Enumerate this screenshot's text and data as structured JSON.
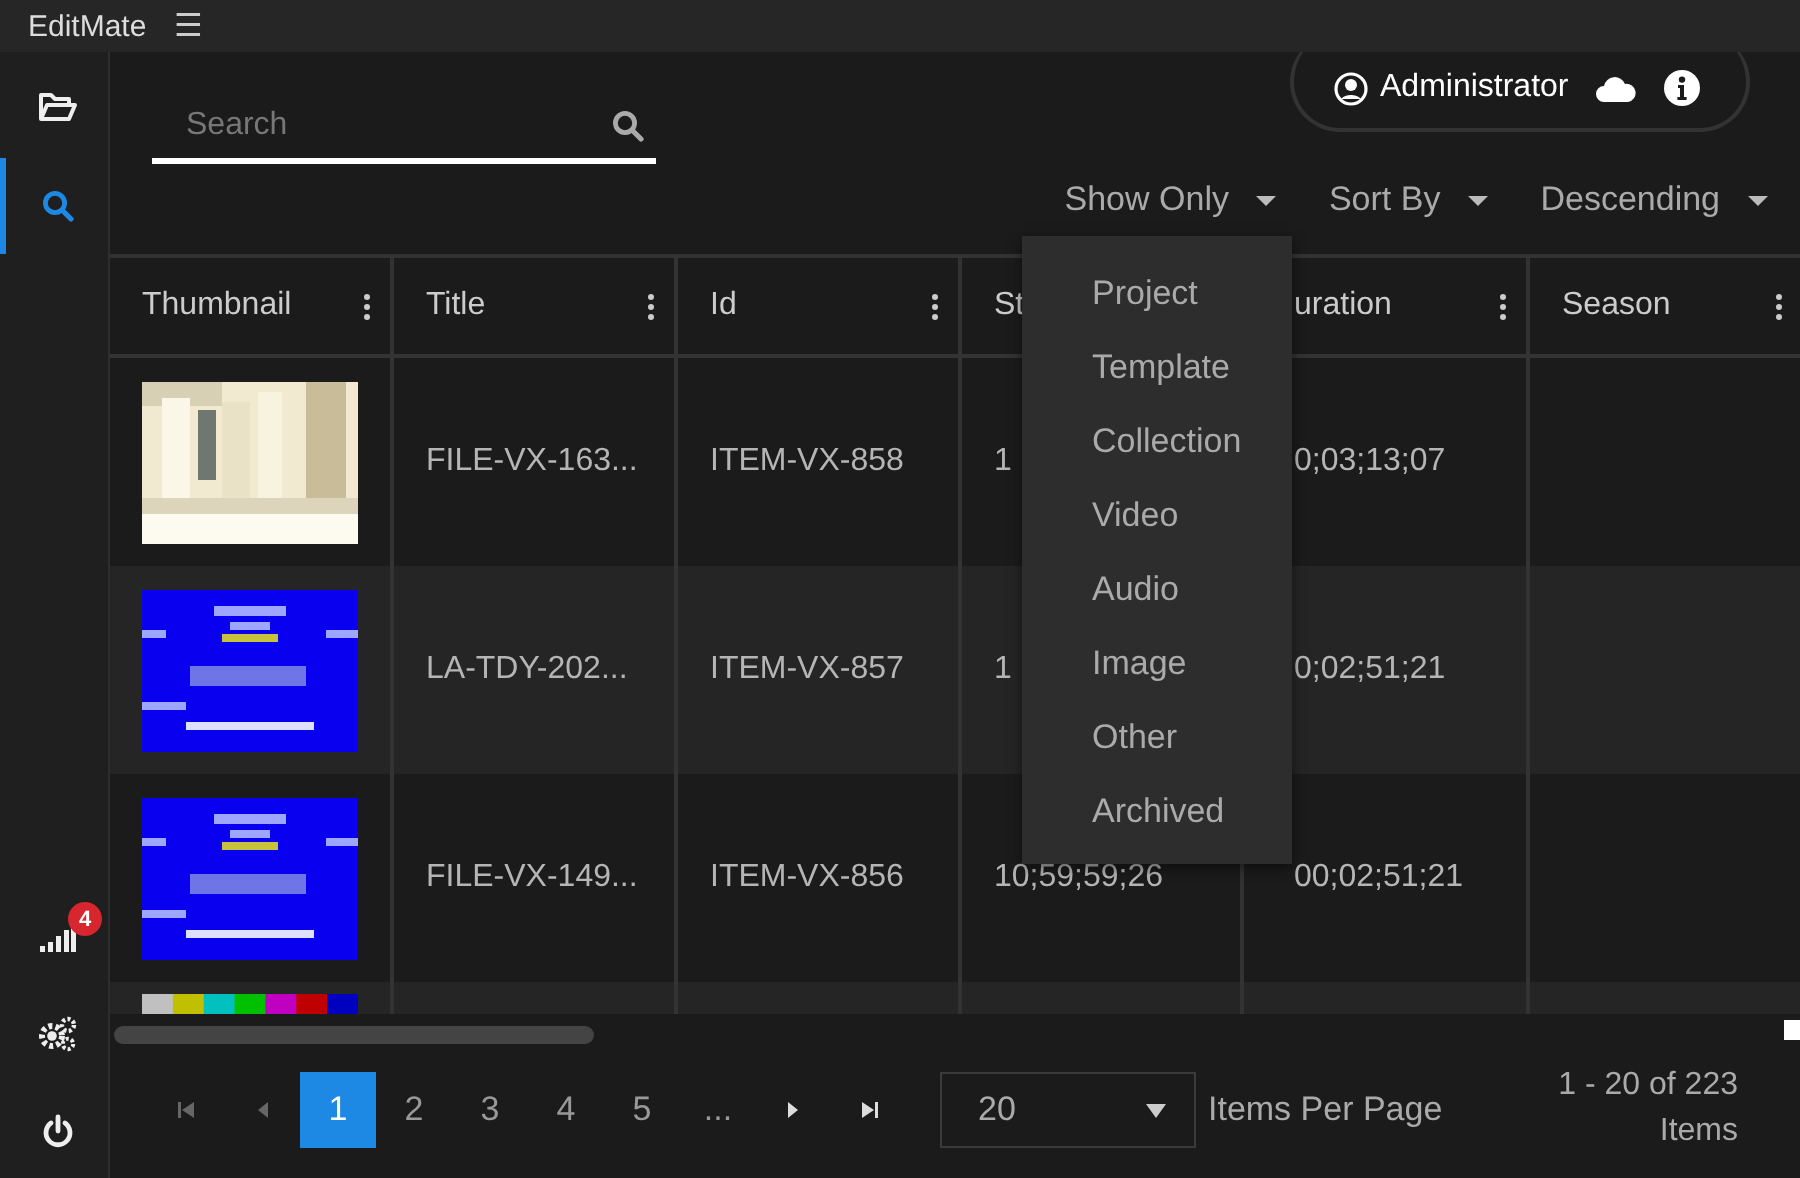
{
  "app": {
    "title": "EditMate",
    "menu_icon": "☰"
  },
  "sidebar": {
    "items": [
      {
        "kind": "folder",
        "selected": false
      },
      {
        "kind": "search",
        "selected": true
      }
    ],
    "bottom_items": [
      {
        "kind": "signal",
        "badge": "4"
      },
      {
        "kind": "gears"
      },
      {
        "kind": "power"
      }
    ]
  },
  "user": {
    "name": "Administrator"
  },
  "search": {
    "placeholder": "Search"
  },
  "filters": [
    "Show Only",
    "Sort By",
    "Descending"
  ],
  "show_only_menu": [
    "Project",
    "Template",
    "Collection",
    "Video",
    "Audio",
    "Image",
    "Other",
    "Archived"
  ],
  "table": {
    "columns": [
      "Thumbnail",
      "Title",
      "Id",
      "St",
      "uration",
      "Season"
    ],
    "rows": [
      {
        "cells": [
          {
            "kind": "picture"
          },
          "FILE-VX-163...",
          "ITEM-VX-858",
          "1",
          "0;03;13;07",
          ""
        ]
      },
      {
        "cells": [
          {
            "kind": "picture"
          },
          "LA-TDY-202...",
          "ITEM-VX-857",
          "1",
          "0;02;51;21",
          ""
        ]
      },
      {
        "cells": [
          {
            "kind": "picture"
          },
          "FILE-VX-149...",
          "ITEM-VX-856",
          "10;59;59;26",
          "00;02;51;21",
          ""
        ]
      },
      {
        "cells": [
          {
            "kind": "picture"
          },
          "",
          "",
          "",
          "",
          ""
        ]
      }
    ]
  },
  "pagination": {
    "pages": [
      {
        "label": "1",
        "selected": true
      },
      {
        "label": "2",
        "selected": false
      },
      {
        "label": "3",
        "selected": false
      },
      {
        "label": "4",
        "selected": false
      },
      {
        "label": "5",
        "selected": false
      },
      {
        "label": "...",
        "selected": false
      }
    ],
    "per_page": "20",
    "per_page_label": "Items Per Page",
    "range": "1 - 20 of 223 Items"
  }
}
